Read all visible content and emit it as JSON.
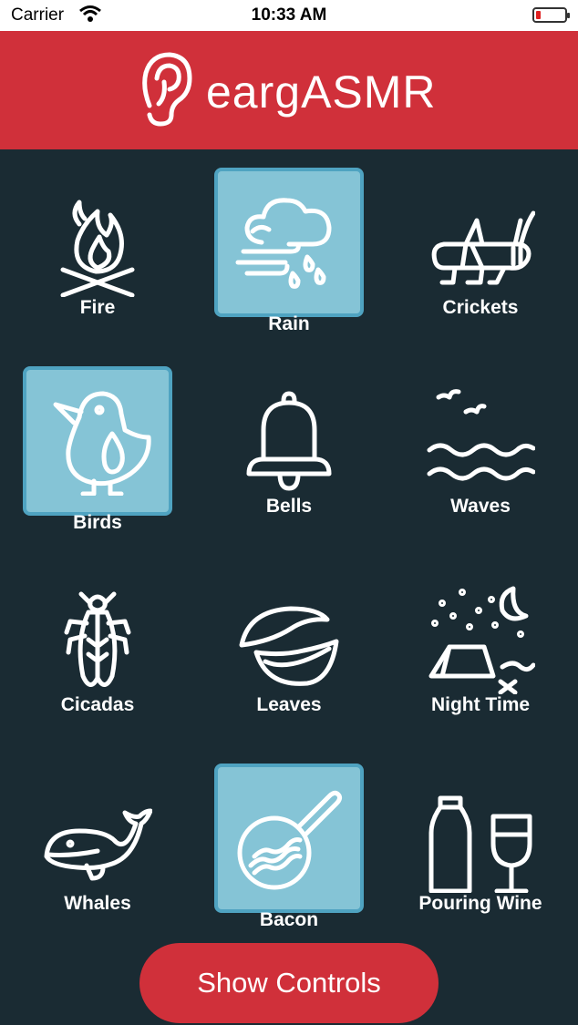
{
  "status_bar": {
    "carrier": "Carrier",
    "time": "10:33 AM",
    "wifi_icon": "wifi-icon",
    "battery_icon": "battery-low-icon",
    "battery_color": "#e02020"
  },
  "header": {
    "title": "eargASMR",
    "logo_icon": "ear-icon",
    "background": "#d0303a"
  },
  "sounds": [
    {
      "label": "Fire",
      "icon": "campfire-icon",
      "selected": false
    },
    {
      "label": "Rain",
      "icon": "rain-cloud-icon",
      "selected": true
    },
    {
      "label": "Crickets",
      "icon": "cricket-icon",
      "selected": false
    },
    {
      "label": "Birds",
      "icon": "bird-icon",
      "selected": true
    },
    {
      "label": "Bells",
      "icon": "bell-icon",
      "selected": false
    },
    {
      "label": "Waves",
      "icon": "waves-icon",
      "selected": false
    },
    {
      "label": "Cicadas",
      "icon": "cicada-icon",
      "selected": false
    },
    {
      "label": "Leaves",
      "icon": "leaves-icon",
      "selected": false
    },
    {
      "label": "Night Time",
      "icon": "tent-night-icon",
      "selected": false
    },
    {
      "label": "Whales",
      "icon": "whale-icon",
      "selected": false
    },
    {
      "label": "Bacon",
      "icon": "bacon-pan-icon",
      "selected": true
    },
    {
      "label": "Pouring Wine",
      "icon": "wine-icon",
      "selected": false
    }
  ],
  "colors": {
    "background": "#1a2b33",
    "selected_fill": "#85c4d6",
    "selected_border": "#4fa3c1",
    "accent": "#d0303a"
  },
  "controls": {
    "show_controls_label": "Show Controls"
  }
}
